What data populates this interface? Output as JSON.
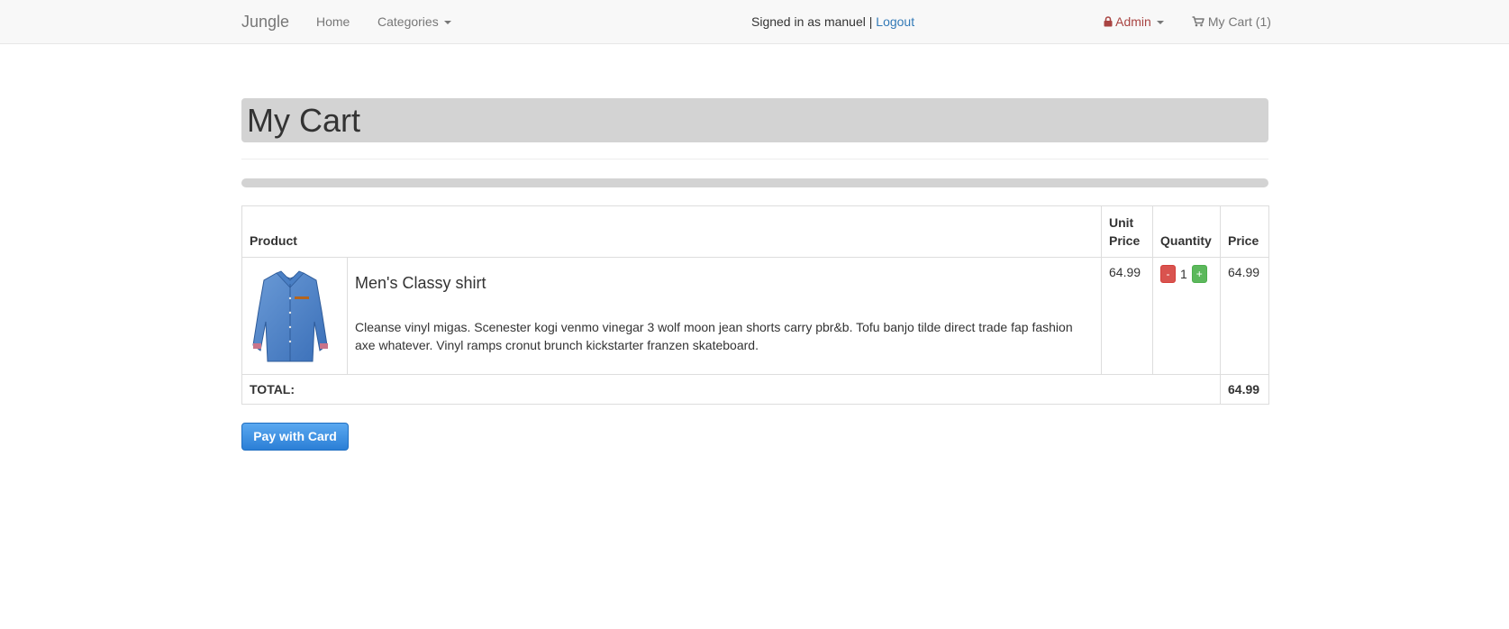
{
  "nav": {
    "brand": "Jungle",
    "home": "Home",
    "categories": "Categories",
    "signed_in_text": "Signed in as manuel |",
    "logout": "Logout",
    "admin": "Admin",
    "cart": "My Cart (1)"
  },
  "page": {
    "title": "My Cart"
  },
  "table": {
    "headers": {
      "product": "Product",
      "unit_price": "Unit Price",
      "quantity": "Quantity",
      "price": "Price"
    },
    "items": [
      {
        "image_icon": "shirt-image",
        "name": "Men's Classy shirt",
        "description": "Cleanse vinyl migas. Scenester kogi venmo vinegar 3 wolf moon jean shorts carry pbr&b. Tofu banjo tilde direct trade fap fashion axe whatever. Vinyl ramps cronut brunch kickstarter franzen skateboard.",
        "unit_price": "64.99",
        "quantity": "1",
        "price": "64.99",
        "minus_label": "-",
        "plus_label": "+"
      }
    ],
    "total_label": "TOTAL:",
    "total_value": "64.99"
  },
  "checkout": {
    "pay_button": "Pay with Card"
  },
  "colors": {
    "navbar_bg": "#f8f8f8",
    "link_blue": "#337ab7",
    "admin_red": "#a94442",
    "minus_red": "#d9534f",
    "plus_green": "#5cb85c",
    "pay_blue": "#2b7fd6",
    "title_bg": "#d3d3d3"
  }
}
